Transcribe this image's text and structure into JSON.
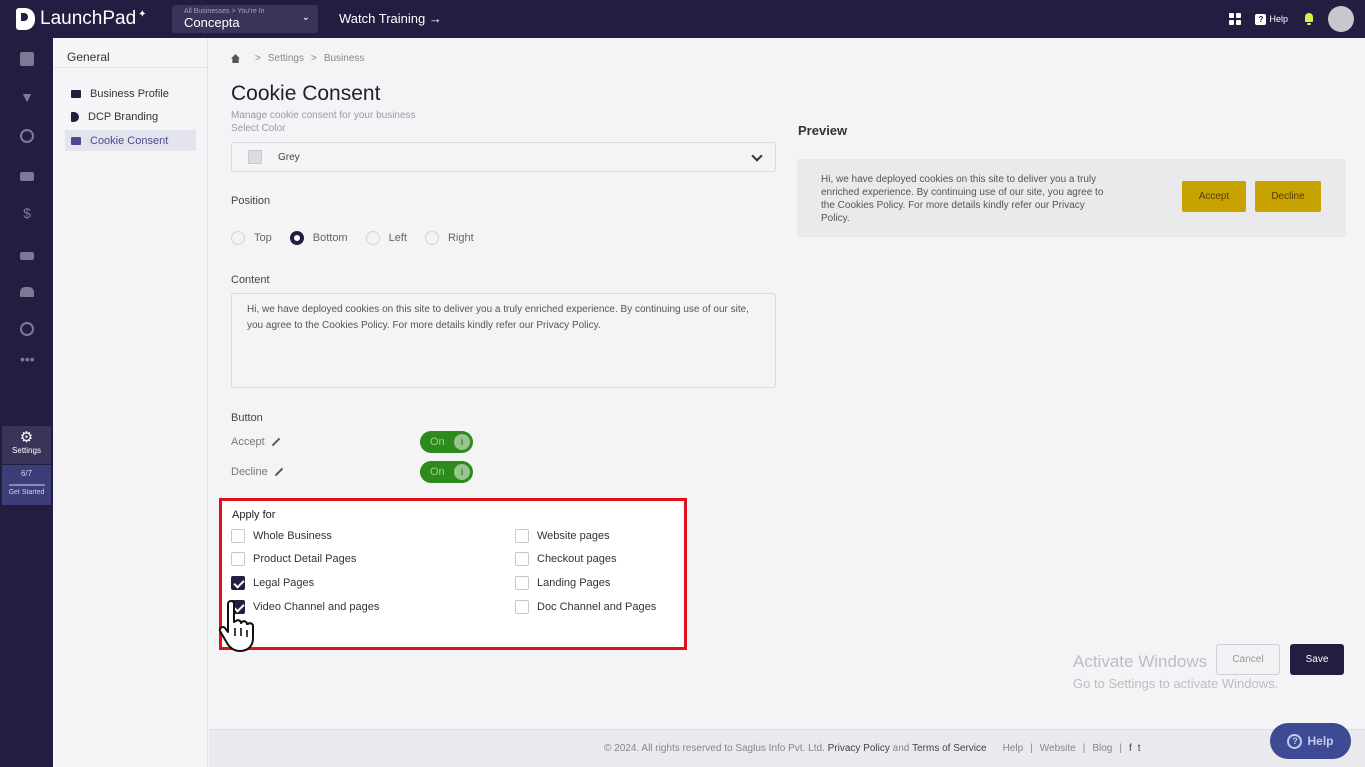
{
  "topbar": {
    "app_name": "LaunchPad",
    "business_switch_caption": "All Businesses > You're In",
    "business_name": "Concepta",
    "watch_training": "Watch Training →",
    "help_label": "Help"
  },
  "rail": {
    "settings_label": "Settings",
    "progress_count": "6/7",
    "get_started_label": "Get Started"
  },
  "subnav": {
    "heading": "General",
    "items": [
      {
        "label": "Business Profile",
        "active": false
      },
      {
        "label": "DCP Branding",
        "active": false
      },
      {
        "label": "Cookie Consent",
        "active": true
      }
    ]
  },
  "breadcrumb": {
    "items": [
      "Settings",
      "Business"
    ]
  },
  "page": {
    "title": "Cookie Consent",
    "subtitle": "Manage cookie consent for your business"
  },
  "color": {
    "label": "Select Color",
    "value": "Grey"
  },
  "position": {
    "label": "Position",
    "options": [
      "Top",
      "Bottom",
      "Left",
      "Right"
    ],
    "selected": "Bottom"
  },
  "content": {
    "label": "Content",
    "text": "Hi, we have deployed cookies on this site to deliver you a truly enriched experience. By continuing use of our site, you agree to the Cookies Policy. For more details kindly refer our Privacy Policy."
  },
  "buttons": {
    "label": "Button",
    "accept_label": "Accept",
    "accept_state": "On",
    "decline_label": "Decline",
    "decline_state": "On"
  },
  "apply_for": {
    "title": "Apply for",
    "left": [
      {
        "label": "Whole Business",
        "checked": false
      },
      {
        "label": "Product Detail Pages",
        "checked": false
      },
      {
        "label": "Legal Pages",
        "checked": true
      },
      {
        "label": "Video Channel and pages",
        "checked": true
      }
    ],
    "right": [
      {
        "label": "Website pages",
        "checked": false
      },
      {
        "label": "Checkout pages",
        "checked": false
      },
      {
        "label": "Landing Pages",
        "checked": false
      },
      {
        "label": "Doc Channel and Pages",
        "checked": false
      }
    ]
  },
  "preview": {
    "title": "Preview",
    "text": "Hi, we have deployed cookies on this site to deliver you a truly enriched experience. By continuing use of our site, you agree to the Cookies Policy. For more details kindly refer our Privacy Policy.",
    "accept": "Accept",
    "decline": "Decline"
  },
  "actions": {
    "cancel": "Cancel",
    "save": "Save"
  },
  "watermark": {
    "line1": "Activate Windows",
    "line2": "Go to Settings to activate Windows."
  },
  "footer": {
    "copyright": "© 2024. All rights reserved to Saglus Info Pvt. Ltd.",
    "privacy": "Privacy Policy",
    "and": "and",
    "terms": "Terms of Service",
    "links": [
      "Help",
      "Website",
      "Blog"
    ],
    "social": [
      "f",
      "t"
    ]
  },
  "help_fab": "Help",
  "colors": {
    "brand_dark": "#231d41",
    "toggle_on": "#2c8b1a",
    "preview_button": "#c8a200",
    "highlight": "#e0101a"
  }
}
